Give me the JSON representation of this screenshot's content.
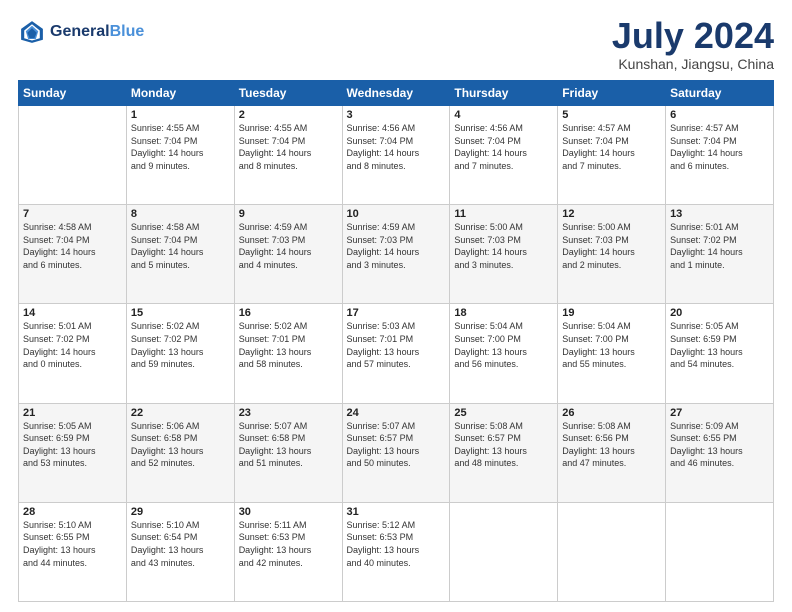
{
  "header": {
    "logo_line1": "General",
    "logo_line2": "Blue",
    "month": "July 2024",
    "location": "Kunshan, Jiangsu, China"
  },
  "weekdays": [
    "Sunday",
    "Monday",
    "Tuesday",
    "Wednesday",
    "Thursday",
    "Friday",
    "Saturday"
  ],
  "weeks": [
    [
      {
        "day": "",
        "info": ""
      },
      {
        "day": "1",
        "info": "Sunrise: 4:55 AM\nSunset: 7:04 PM\nDaylight: 14 hours\nand 9 minutes."
      },
      {
        "day": "2",
        "info": "Sunrise: 4:55 AM\nSunset: 7:04 PM\nDaylight: 14 hours\nand 8 minutes."
      },
      {
        "day": "3",
        "info": "Sunrise: 4:56 AM\nSunset: 7:04 PM\nDaylight: 14 hours\nand 8 minutes."
      },
      {
        "day": "4",
        "info": "Sunrise: 4:56 AM\nSunset: 7:04 PM\nDaylight: 14 hours\nand 7 minutes."
      },
      {
        "day": "5",
        "info": "Sunrise: 4:57 AM\nSunset: 7:04 PM\nDaylight: 14 hours\nand 7 minutes."
      },
      {
        "day": "6",
        "info": "Sunrise: 4:57 AM\nSunset: 7:04 PM\nDaylight: 14 hours\nand 6 minutes."
      }
    ],
    [
      {
        "day": "7",
        "info": "Sunrise: 4:58 AM\nSunset: 7:04 PM\nDaylight: 14 hours\nand 6 minutes."
      },
      {
        "day": "8",
        "info": "Sunrise: 4:58 AM\nSunset: 7:04 PM\nDaylight: 14 hours\nand 5 minutes."
      },
      {
        "day": "9",
        "info": "Sunrise: 4:59 AM\nSunset: 7:03 PM\nDaylight: 14 hours\nand 4 minutes."
      },
      {
        "day": "10",
        "info": "Sunrise: 4:59 AM\nSunset: 7:03 PM\nDaylight: 14 hours\nand 3 minutes."
      },
      {
        "day": "11",
        "info": "Sunrise: 5:00 AM\nSunset: 7:03 PM\nDaylight: 14 hours\nand 3 minutes."
      },
      {
        "day": "12",
        "info": "Sunrise: 5:00 AM\nSunset: 7:03 PM\nDaylight: 14 hours\nand 2 minutes."
      },
      {
        "day": "13",
        "info": "Sunrise: 5:01 AM\nSunset: 7:02 PM\nDaylight: 14 hours\nand 1 minute."
      }
    ],
    [
      {
        "day": "14",
        "info": "Sunrise: 5:01 AM\nSunset: 7:02 PM\nDaylight: 14 hours\nand 0 minutes."
      },
      {
        "day": "15",
        "info": "Sunrise: 5:02 AM\nSunset: 7:02 PM\nDaylight: 13 hours\nand 59 minutes."
      },
      {
        "day": "16",
        "info": "Sunrise: 5:02 AM\nSunset: 7:01 PM\nDaylight: 13 hours\nand 58 minutes."
      },
      {
        "day": "17",
        "info": "Sunrise: 5:03 AM\nSunset: 7:01 PM\nDaylight: 13 hours\nand 57 minutes."
      },
      {
        "day": "18",
        "info": "Sunrise: 5:04 AM\nSunset: 7:00 PM\nDaylight: 13 hours\nand 56 minutes."
      },
      {
        "day": "19",
        "info": "Sunrise: 5:04 AM\nSunset: 7:00 PM\nDaylight: 13 hours\nand 55 minutes."
      },
      {
        "day": "20",
        "info": "Sunrise: 5:05 AM\nSunset: 6:59 PM\nDaylight: 13 hours\nand 54 minutes."
      }
    ],
    [
      {
        "day": "21",
        "info": "Sunrise: 5:05 AM\nSunset: 6:59 PM\nDaylight: 13 hours\nand 53 minutes."
      },
      {
        "day": "22",
        "info": "Sunrise: 5:06 AM\nSunset: 6:58 PM\nDaylight: 13 hours\nand 52 minutes."
      },
      {
        "day": "23",
        "info": "Sunrise: 5:07 AM\nSunset: 6:58 PM\nDaylight: 13 hours\nand 51 minutes."
      },
      {
        "day": "24",
        "info": "Sunrise: 5:07 AM\nSunset: 6:57 PM\nDaylight: 13 hours\nand 50 minutes."
      },
      {
        "day": "25",
        "info": "Sunrise: 5:08 AM\nSunset: 6:57 PM\nDaylight: 13 hours\nand 48 minutes."
      },
      {
        "day": "26",
        "info": "Sunrise: 5:08 AM\nSunset: 6:56 PM\nDaylight: 13 hours\nand 47 minutes."
      },
      {
        "day": "27",
        "info": "Sunrise: 5:09 AM\nSunset: 6:55 PM\nDaylight: 13 hours\nand 46 minutes."
      }
    ],
    [
      {
        "day": "28",
        "info": "Sunrise: 5:10 AM\nSunset: 6:55 PM\nDaylight: 13 hours\nand 44 minutes."
      },
      {
        "day": "29",
        "info": "Sunrise: 5:10 AM\nSunset: 6:54 PM\nDaylight: 13 hours\nand 43 minutes."
      },
      {
        "day": "30",
        "info": "Sunrise: 5:11 AM\nSunset: 6:53 PM\nDaylight: 13 hours\nand 42 minutes."
      },
      {
        "day": "31",
        "info": "Sunrise: 5:12 AM\nSunset: 6:53 PM\nDaylight: 13 hours\nand 40 minutes."
      },
      {
        "day": "",
        "info": ""
      },
      {
        "day": "",
        "info": ""
      },
      {
        "day": "",
        "info": ""
      }
    ]
  ]
}
